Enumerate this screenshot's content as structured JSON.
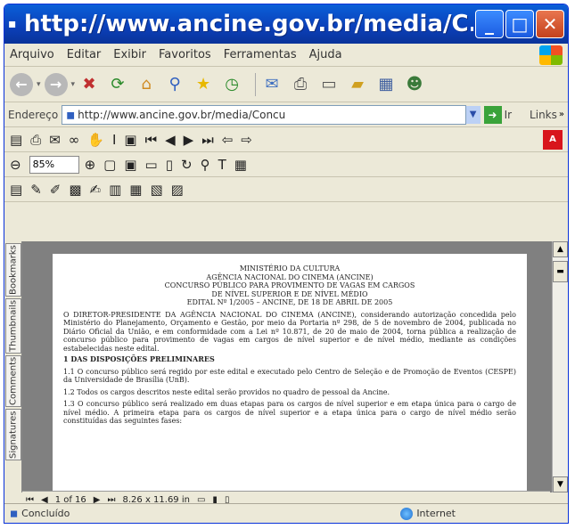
{
  "window": {
    "title": "http://www.ancine.gov.br/media/C...",
    "minimize": "_",
    "maximize": "□",
    "close": "✕"
  },
  "menu": [
    "Arquivo",
    "Editar",
    "Exibir",
    "Favoritos",
    "Ferramentas",
    "Ajuda"
  ],
  "toolbar": {
    "back": "←",
    "forward": "→"
  },
  "address": {
    "label": "Endereço",
    "url": "http://www.ancine.gov.br/media/Concu",
    "go_label": "Ir",
    "links_label": "Links"
  },
  "pdf": {
    "zoom": "85%"
  },
  "nav_tabs": [
    "Bookmarks",
    "Thumbnails",
    "Comments",
    "Signatures"
  ],
  "document": {
    "head": [
      "MINISTÉRIO DA CULTURA",
      "AGÊNCIA NACIONAL DO CINEMA (ANCINE)",
      "CONCURSO PÚBLICO PARA PROVIMENTO DE VAGAS EM CARGOS",
      "DE NÍVEL SUPERIOR E DE NÍVEL MÉDIO",
      "EDITAL Nº 1/2005 – ANCINE, DE 18 DE ABRIL DE 2005"
    ],
    "intro": "O DIRETOR-PRESIDENTE DA AGÊNCIA NACIONAL DO CINEMA (ANCINE), considerando autorização concedida pelo Ministério do Planejamento, Orçamento e Gestão, por meio da Portaria nº 298, de 5 de novembro de 2004, publicada no Diário Oficial da União, e em conformidade com a Lei nº 10.871, de 20 de maio de 2004, torna pública a realização de concurso público para provimento de vagas em cargos de nível superior e de nível médio, mediante as condições estabelecidas neste edital.",
    "section": "1 DAS DISPOSIÇÕES PRELIMINARES",
    "items": [
      "1.1 O concurso público será regido por este edital e executado pelo Centro de Seleção e de Promoção de Eventos (CESPE) da Universidade de Brasília (UnB).",
      "1.2 Todos os cargos descritos neste edital serão providos no quadro de pessoal da Ancine.",
      "1.3 O concurso público será realizado em duas etapas para os cargos de nível superior e em etapa única para o cargo de nível médio. A primeira etapa para os cargos de nível superior e a etapa única para o cargo de nível médio serão constituídas das seguintes fases:"
    ]
  },
  "pagebar": {
    "page": "1 of 16",
    "size": "8.26 x 11.69 in"
  },
  "status": {
    "left": "Concluído",
    "zone": "Internet"
  }
}
